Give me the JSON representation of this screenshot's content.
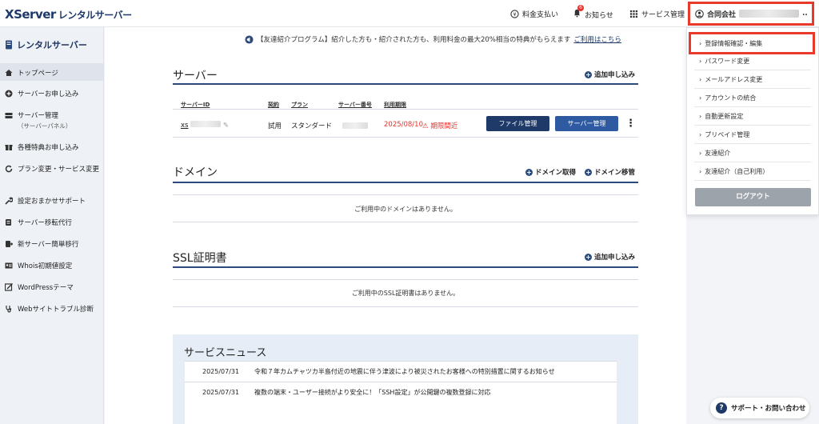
{
  "header": {
    "logo": "XServer",
    "logo_sub": "レンタルサーバー",
    "payment": "料金支払い",
    "notices": "お知らせ",
    "notice_count": "6",
    "services": "サービス管理",
    "company": "合同会社",
    "company_suffix": ".."
  },
  "sidebar": {
    "title": "レンタルサーバー",
    "items": [
      {
        "label": "トップページ"
      },
      {
        "label": "サーバーお申し込み"
      },
      {
        "label": "サーバー管理",
        "sub": "（サーバーパネル）"
      },
      {
        "label": "各種特典お申し込み"
      },
      {
        "label": "プラン変更・サービス変更"
      },
      {
        "label": "設定おまかせサポート"
      },
      {
        "label": "サーバー移転代行"
      },
      {
        "label": "新サーバー簡単移行"
      },
      {
        "label": "Whois初期値設定"
      },
      {
        "label": "WordPressテーマ"
      },
      {
        "label": "Webサイトトラブル診断"
      }
    ]
  },
  "notice": {
    "text": "【友達紹介プログラム】紹介した方も・紹介された方も、利用料金の最大20%相当の特典がもらえます",
    "link": "ご利用はこちら"
  },
  "server": {
    "title": "サーバー",
    "add": "追加申し込み",
    "headers": [
      "サーバーID",
      "契約",
      "プラン",
      "サーバー番号",
      "利用期限"
    ],
    "row": {
      "id": "xs",
      "contract": "試用",
      "plan": "スタンダード",
      "expiry": "2025/08/10",
      "status": "期限間近",
      "file_btn": "ファイル管理",
      "server_btn": "サーバー管理",
      "more": "⋮"
    }
  },
  "domain": {
    "title": "ドメイン",
    "acquire": "ドメイン取得",
    "transfer": "ドメイン移管",
    "empty": "ご利用中のドメインはありません。"
  },
  "ssl": {
    "title": "SSL証明書",
    "add": "追加申し込み",
    "empty": "ご利用中のSSL証明書はありません。"
  },
  "news": {
    "title": "サービスニュース",
    "items": [
      {
        "date": "2025/07/31",
        "text": "令和７年カムチャツカ半島付近の地震に伴う津波により被災されたお客様への特別措置に関するお知らせ"
      },
      {
        "date": "2025/07/31",
        "text": "複数の端末・ユーザー接続がより安全に！「SSH設定」が公開鍵の複数登録に対応"
      }
    ]
  },
  "dropdown": {
    "items": [
      {
        "label": "登録情報確認・編集"
      },
      {
        "label": "パスワード変更"
      },
      {
        "label": "メールアドレス変更"
      },
      {
        "label": "アカウントの統合"
      },
      {
        "label": "自動更新設定"
      },
      {
        "label": "プリペイド管理"
      },
      {
        "label": "友達紹介"
      },
      {
        "label": "友達紹介（自己利用）"
      }
    ],
    "logout": "ログアウト"
  },
  "support": "サポート・お問い合わせ",
  "colors": {
    "brand": "#1f3a68",
    "highlight": "#e83a2a",
    "warning": "#e5322d"
  }
}
